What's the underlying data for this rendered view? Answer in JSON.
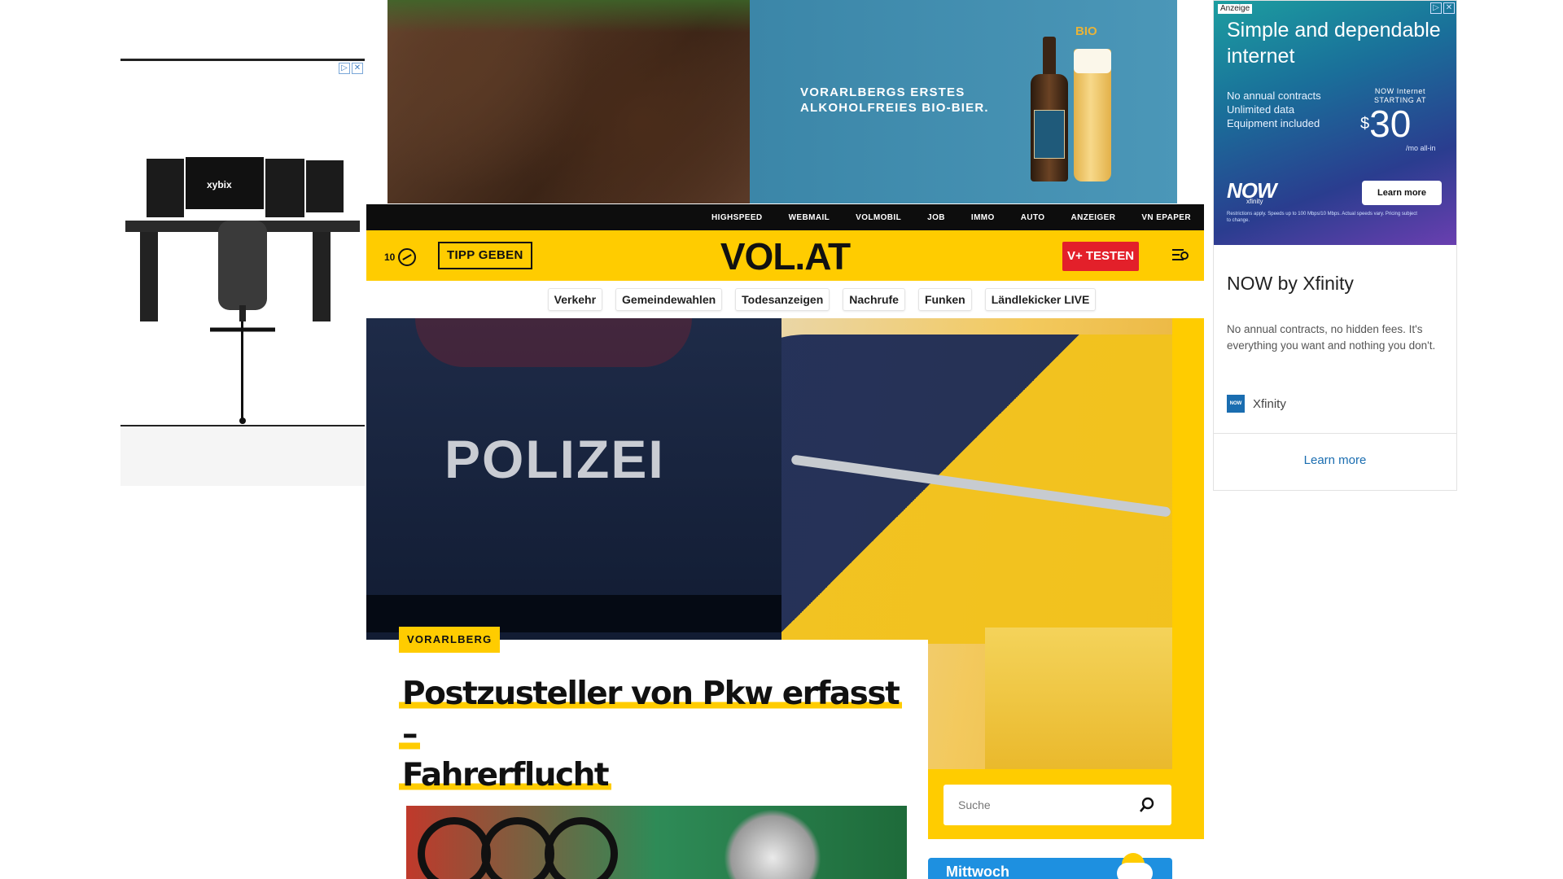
{
  "top_banner_ad": {
    "slogan_line1": "VORARLBERGS ERSTES",
    "slogan_line2": "ALKOHOLFREIES BIO-BIER.",
    "bio_label": "BIO"
  },
  "left_ad": {
    "brand": "xybix"
  },
  "top_nav": {
    "items": [
      "HIGHSPEED",
      "WEBMAIL",
      "VOLMOBIL",
      "JOB",
      "IMMO",
      "AUTO",
      "ANZEIGER",
      "VN EPAPER"
    ]
  },
  "header": {
    "counter": "10",
    "tipp_label": "TIPP GEBEN",
    "logo": "VOL.AT",
    "vplus_label": "V+ TESTEN"
  },
  "topic_pills": [
    "Verkehr",
    "Gemeindewahlen",
    "Todesanzeigen",
    "Nachrufe",
    "Funken",
    "Ländlekicker LIVE"
  ],
  "hero": {
    "image_text": "POLIZEI",
    "kicker": "VORARLBERG",
    "headline_line1": "Postzusteller von Pkw erfasst –",
    "headline_line2": "Fahrerflucht"
  },
  "search": {
    "placeholder": "Suche"
  },
  "weather": {
    "day": "Mittwoch"
  },
  "right_ad": {
    "badge": "Anzeige",
    "headline": "Simple and dependable internet",
    "bullets": [
      "No annual contracts",
      "Unlimited data",
      "Equipment included"
    ],
    "price_caption": "NOW Internet STARTING AT",
    "price_currency": "$",
    "price_value": "30",
    "price_period": "/mo all-in",
    "brand_mark": "NOW",
    "brand_sub": "xfinity",
    "cta": "Learn more",
    "fine_print": "Restrictions apply. Speeds up to 100 Mbps/10 Mbps. Actual speeds vary. Pricing subject to change.",
    "title": "NOW by Xfinity",
    "description": "No annual contracts, no hidden fees. It's everything you want and nothing you don't.",
    "advertiser": "Xfinity",
    "advertiser_logo_text": "NOW",
    "learn_more": "Learn more"
  },
  "colors": {
    "brand_yellow": "#ffcc00",
    "accent_red": "#e3202a",
    "nav_black": "#0d0d0d",
    "weather_blue": "#1e90e0",
    "ad_link_blue": "#1a6db0"
  }
}
